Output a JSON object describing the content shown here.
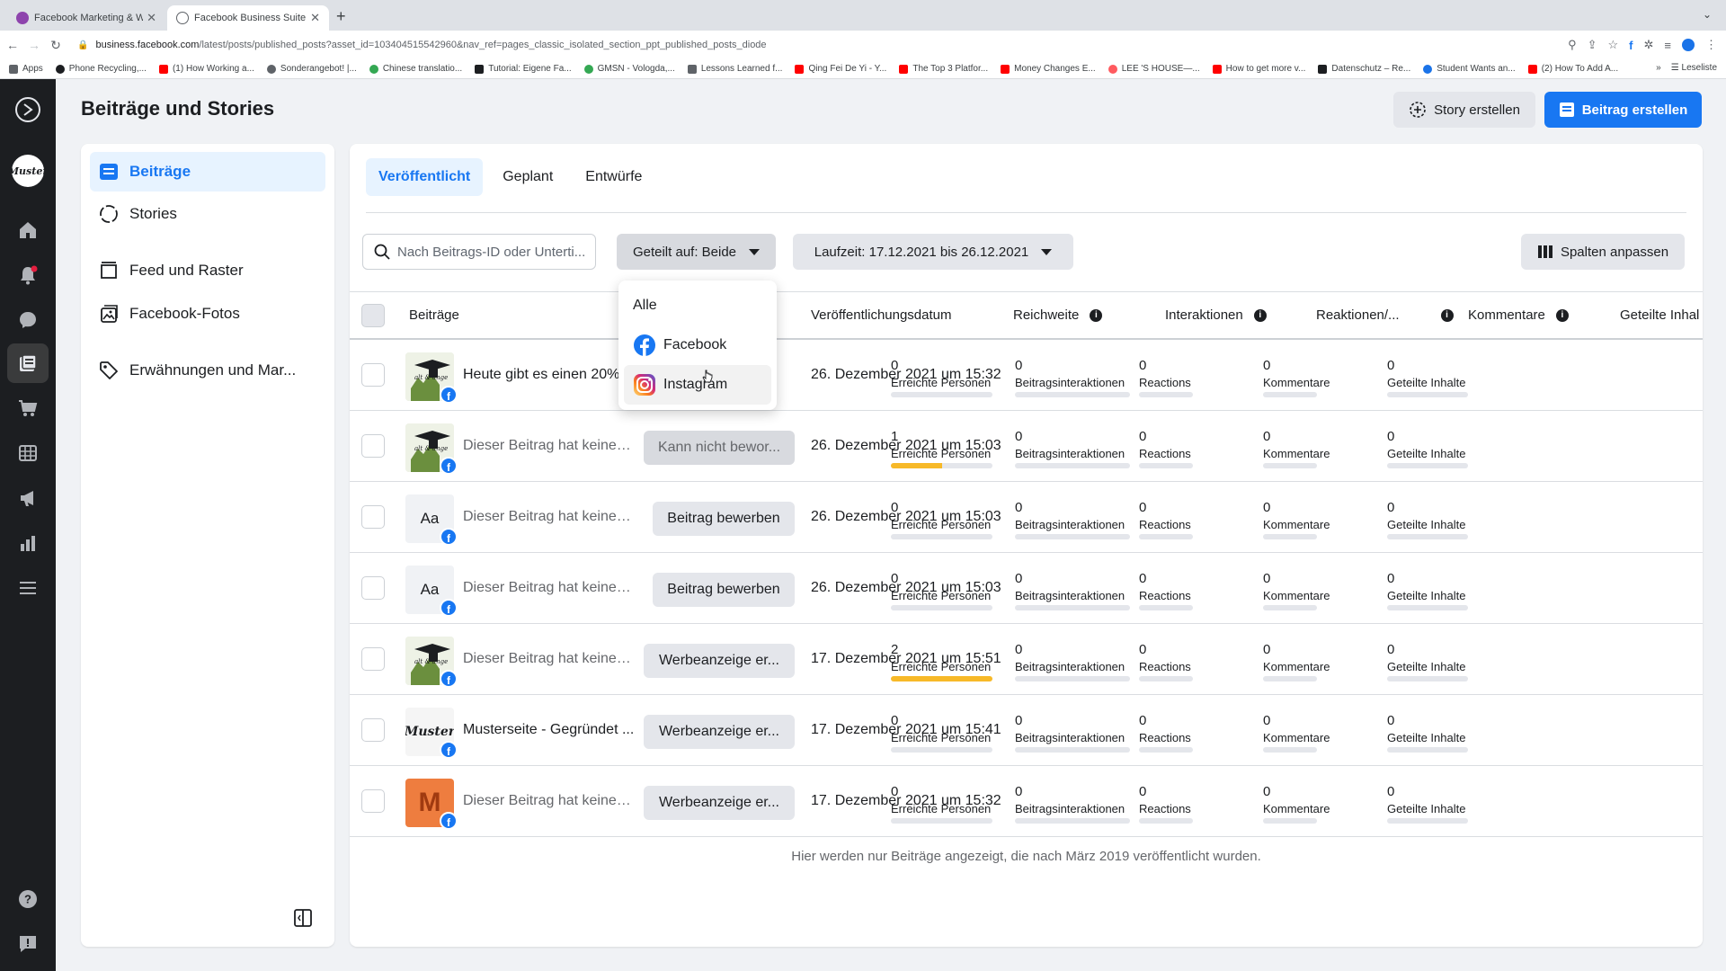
{
  "browser": {
    "tabs": [
      {
        "title": "Facebook Marketing & Werbea",
        "active": false
      },
      {
        "title": "Facebook Business Suite",
        "active": true
      }
    ],
    "url_host": "business.facebook.com",
    "url_path": "/latest/posts/published_posts?asset_id=103404515542960&nav_ref=pages_classic_isolated_section_ppt_published_posts_diode",
    "bookmarks": [
      {
        "label": "Apps",
        "color": "#5f6368"
      },
      {
        "label": "Phone Recycling,...",
        "color": "#1c1e21"
      },
      {
        "label": "(1) How Working a...",
        "color": "#ff0000"
      },
      {
        "label": "Sonderangebot! |...",
        "color": "#5f6368"
      },
      {
        "label": "Chinese translatio...",
        "color": "#34a853"
      },
      {
        "label": "Tutorial: Eigene Fa...",
        "color": "#1c1e21"
      },
      {
        "label": "GMSN - Vologda,...",
        "color": "#34a853"
      },
      {
        "label": "Lessons Learned f...",
        "color": "#5f6368"
      },
      {
        "label": "Qing Fei De Yi - Y...",
        "color": "#ff0000"
      },
      {
        "label": "The Top 3 Platfor...",
        "color": "#ff0000"
      },
      {
        "label": "Money Changes E...",
        "color": "#ff0000"
      },
      {
        "label": "LEE 'S HOUSE—...",
        "color": "#ff5a5f"
      },
      {
        "label": "How to get more v...",
        "color": "#ff0000"
      },
      {
        "label": "Datenschutz – Re...",
        "color": "#1c1e21"
      },
      {
        "label": "Student Wants an...",
        "color": "#1a73e8"
      },
      {
        "label": "(2) How To Add A...",
        "color": "#ff0000"
      }
    ],
    "reading_list": "Leseliste"
  },
  "header": {
    "title": "Beiträge und Stories",
    "story_button": "Story erstellen",
    "post_button": "Beitrag erstellen"
  },
  "sidebar": {
    "items": [
      {
        "label": "Beiträge",
        "active": true
      },
      {
        "label": "Stories",
        "active": false
      },
      {
        "label": "Feed und Raster",
        "active": false
      },
      {
        "label": "Facebook-Fotos",
        "active": false
      },
      {
        "label": "Erwähnungen und Mar...",
        "active": false
      }
    ]
  },
  "rail": {
    "avatar_text": "Muster"
  },
  "main": {
    "tabs": [
      {
        "label": "Veröffentlicht",
        "active": true
      },
      {
        "label": "Geplant",
        "active": false
      },
      {
        "label": "Entwürfe",
        "active": false
      }
    ],
    "search_placeholder": "Nach Beitrags-ID oder Unterti...",
    "filter_shared": "Geteilt auf: Beide",
    "filter_date": "Laufzeit: 17.12.2021 bis 26.12.2021",
    "columns_button": "Spalten anpassen",
    "columns": {
      "posts": "Beiträge",
      "date": "Veröffentlichungsdatum",
      "reach": "Reichweite",
      "interactions": "Interaktionen",
      "reactions": "Reaktionen/...",
      "comments": "Kommentare",
      "shares": "Geteilte Inhal"
    },
    "rows": [
      {
        "thumb": "img",
        "thumb_text": "",
        "text": "Heute gibt es einen 20%",
        "text_style": "dark",
        "button": "",
        "date": "26. Dezember 2021 um 15:32",
        "reach": "0",
        "reach_fill": 0,
        "interactions": "0",
        "reactions": "0",
        "comments": "0",
        "shares": "0"
      },
      {
        "thumb": "img",
        "thumb_text": "",
        "text": "Dieser Beitrag hat keinen ...",
        "text_style": "grey",
        "button": "Kann nicht bewor...",
        "button_style": "wide disabled",
        "date": "26. Dezember 2021 um 15:03",
        "reach": "1",
        "reach_fill": 0.5,
        "interactions": "0",
        "reactions": "0",
        "comments": "0",
        "shares": "0"
      },
      {
        "thumb": "text",
        "thumb_text": "Aa",
        "text": "Dieser Beitrag hat keinen T...",
        "text_style": "grey",
        "button": "Beitrag bewerben",
        "button_style": "narrow",
        "date": "26. Dezember 2021 um 15:03",
        "reach": "0",
        "reach_fill": 0,
        "interactions": "0",
        "reactions": "0",
        "comments": "0",
        "shares": "0"
      },
      {
        "thumb": "text",
        "thumb_text": "Aa",
        "text": "Dieser Beitrag hat keinen T...",
        "text_style": "grey",
        "button": "Beitrag bewerben",
        "button_style": "narrow",
        "date": "26. Dezember 2021 um 15:03",
        "reach": "0",
        "reach_fill": 0,
        "interactions": "0",
        "reactions": "0",
        "comments": "0",
        "shares": "0"
      },
      {
        "thumb": "img",
        "thumb_text": "",
        "text": "Dieser Beitrag hat keinen ...",
        "text_style": "grey",
        "button": "Werbeanzeige er...",
        "button_style": "wide",
        "date": "17. Dezember 2021 um 15:51",
        "reach": "2",
        "reach_fill": 1,
        "interactions": "0",
        "reactions": "0",
        "comments": "0",
        "shares": "0"
      },
      {
        "thumb": "logo",
        "thumb_text": "Muster",
        "text": "Musterseite - Gegründet ...",
        "text_style": "dark",
        "button": "Werbeanzeige er...",
        "button_style": "wide",
        "date": "17. Dezember 2021 um 15:41",
        "reach": "0",
        "reach_fill": 0,
        "interactions": "0",
        "reactions": "0",
        "comments": "0",
        "shares": "0"
      },
      {
        "thumb": "orange",
        "thumb_text": "M",
        "text": "Dieser Beitrag hat keinen ...",
        "text_style": "grey",
        "button": "Werbeanzeige er...",
        "button_style": "wide",
        "date": "17. Dezember 2021 um 15:32",
        "reach": "0",
        "reach_fill": 0,
        "interactions": "0",
        "reactions": "0",
        "comments": "0",
        "shares": "0"
      }
    ],
    "metric_labels": {
      "reach": "Erreichte Personen",
      "interactions": "Beitragsinteraktionen",
      "reactions": "Reactions",
      "comments": "Kommentare",
      "shares": "Geteilte Inhalte"
    },
    "footnote": "Hier werden nur Beiträge angezeigt, die nach März 2019 veröffentlicht wurden."
  },
  "dropdown": {
    "items": [
      {
        "label": "Alle",
        "icon": "none"
      },
      {
        "label": "Facebook",
        "icon": "facebook-icon"
      },
      {
        "label": "Instagram",
        "icon": "instagram-icon",
        "hover": true
      }
    ]
  },
  "colors": {
    "accent": "#1877f2",
    "reach_bar": "#f7b928"
  }
}
